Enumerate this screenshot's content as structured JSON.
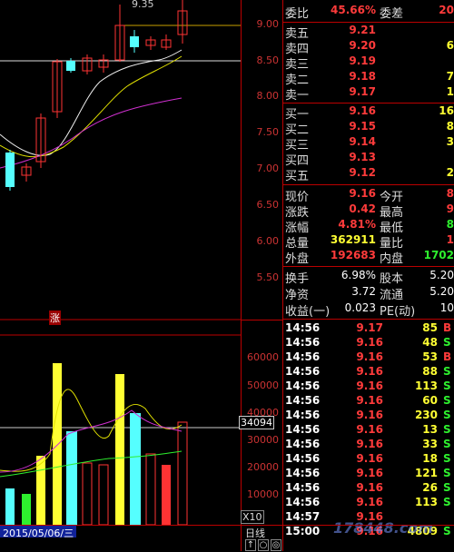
{
  "chart": {
    "high_label": "9.35",
    "rise_tag": "涨",
    "price_axis": [
      "9.00",
      "8.50",
      "8.00",
      "7.50",
      "7.00",
      "6.50",
      "6.00",
      "5.50"
    ],
    "volume_axis": [
      "60000",
      "50000",
      "40000",
      "30000",
      "20000",
      "10000"
    ],
    "volume_readout": "34094",
    "scale_tag": "X10",
    "date_label": "2015/05/06/三",
    "period_button": "日线",
    "ctrl_buttons": [
      "↑",
      "○",
      "◎"
    ]
  },
  "order_book": {
    "committee_ratio_label": "委比",
    "committee_ratio_value": "45.66%",
    "committee_diff_label": "委差",
    "committee_diff_value": "20",
    "asks": [
      {
        "label": "卖五",
        "price": "9.21",
        "vol": ""
      },
      {
        "label": "卖四",
        "price": "9.20",
        "vol": "6"
      },
      {
        "label": "卖三",
        "price": "9.19",
        "vol": ""
      },
      {
        "label": "卖二",
        "price": "9.18",
        "vol": "7"
      },
      {
        "label": "卖一",
        "price": "9.17",
        "vol": "1"
      }
    ],
    "bids": [
      {
        "label": "买一",
        "price": "9.16",
        "vol": "16"
      },
      {
        "label": "买二",
        "price": "9.15",
        "vol": "8"
      },
      {
        "label": "买三",
        "price": "9.14",
        "vol": "3"
      },
      {
        "label": "买四",
        "price": "9.13",
        "vol": ""
      },
      {
        "label": "买五",
        "price": "9.12",
        "vol": "2"
      }
    ]
  },
  "quote": [
    {
      "l1": "现价",
      "v1": "9.16",
      "l2": "今开",
      "v2": "8"
    },
    {
      "l1": "涨跌",
      "v1": "0.42",
      "l2": "最高",
      "v2": "9"
    },
    {
      "l1": "涨幅",
      "v1": "4.81%",
      "l2": "最低",
      "v2": "8"
    },
    {
      "l1": "总量",
      "v1": "362911",
      "l2": "量比",
      "v2": "1"
    },
    {
      "l1": "外盘",
      "v1": "192683",
      "l2": "内盘",
      "v2": "1702"
    }
  ],
  "fundamentals": [
    {
      "l1": "换手",
      "v1": "6.98%",
      "l2": "股本",
      "v2": "5.20"
    },
    {
      "l1": "净资",
      "v1": "3.72",
      "l2": "流通",
      "v2": "5.20"
    },
    {
      "l1": "收益(一)",
      "v1": "0.023",
      "l2": "PE(动)",
      "v2": "10"
    }
  ],
  "ticks": [
    {
      "t": "14:56",
      "p": "9.17",
      "v": "85",
      "s": "B"
    },
    {
      "t": "14:56",
      "p": "9.16",
      "v": "48",
      "s": "S"
    },
    {
      "t": "14:56",
      "p": "9.16",
      "v": "53",
      "s": "B"
    },
    {
      "t": "14:56",
      "p": "9.16",
      "v": "88",
      "s": "S"
    },
    {
      "t": "14:56",
      "p": "9.16",
      "v": "113",
      "s": "S"
    },
    {
      "t": "14:56",
      "p": "9.16",
      "v": "60",
      "s": "S"
    },
    {
      "t": "14:56",
      "p": "9.16",
      "v": "230",
      "s": "S"
    },
    {
      "t": "14:56",
      "p": "9.16",
      "v": "13",
      "s": "S"
    },
    {
      "t": "14:56",
      "p": "9.16",
      "v": "33",
      "s": "S"
    },
    {
      "t": "14:56",
      "p": "9.16",
      "v": "18",
      "s": "S"
    },
    {
      "t": "14:56",
      "p": "9.16",
      "v": "121",
      "s": "S"
    },
    {
      "t": "14:56",
      "p": "9.16",
      "v": "26",
      "s": "S"
    },
    {
      "t": "14:56",
      "p": "9.16",
      "v": "113",
      "s": "S"
    },
    {
      "t": "14:57",
      "p": "9.16",
      "v": "",
      "s": ""
    },
    {
      "t": "15:00",
      "p": "9.16",
      "v": "4809",
      "s": "S"
    }
  ],
  "watermark": "178448.com",
  "colors": {
    "up": "#ff3b3b",
    "down": "#2ef02e",
    "grid": "#bb0000",
    "yellow": "#ffff33",
    "cyan": "#55ffff"
  }
}
